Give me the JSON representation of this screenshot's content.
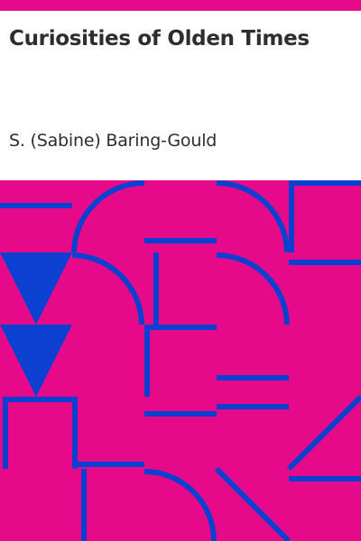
{
  "cover": {
    "title": "Curiosities of Olden Times",
    "author": "S. (Sabine) Baring-Gould",
    "colors": {
      "background": "#e60a8a",
      "pattern": "#0c40d0",
      "panel": "#ffffff",
      "text": "#2d2d2d"
    }
  }
}
